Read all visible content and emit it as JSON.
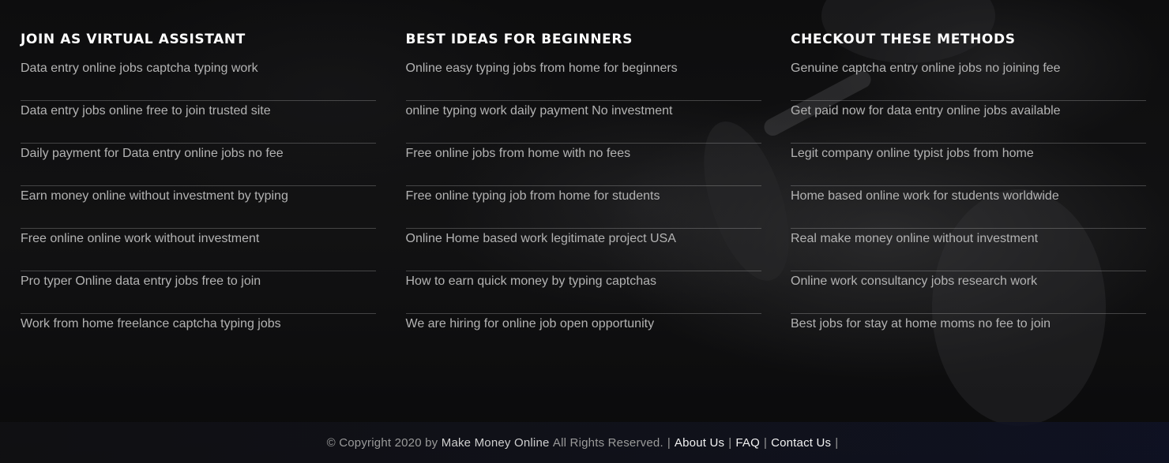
{
  "columns": [
    {
      "title": "JOIN AS VIRTUAL ASSISTANT",
      "links": [
        "Data entry online jobs captcha typing work",
        "Data entry jobs online free to join trusted site",
        "Daily payment for Data entry online jobs no fee",
        "Earn money online without investment by typing",
        "Free online online work without investment",
        "Pro typer Online data entry jobs free to join",
        "Work from home freelance captcha typing jobs"
      ]
    },
    {
      "title": "BEST IDEAS FOR BEGINNERS",
      "links": [
        "Online easy typing jobs from home for beginners",
        "online typing work daily payment No investment",
        "Free online jobs from home with no fees",
        "Free online typing job from home for students",
        "Online Home based work legitimate project USA",
        "How to earn quick money by typing captchas",
        "We are hiring for online job open opportunity"
      ]
    },
    {
      "title": "CHECKOUT THESE METHODS",
      "links": [
        "Genuine captcha entry online jobs no joining fee",
        "Get paid now for data entry online jobs available",
        "Legit company online typist jobs from home",
        "Home based online work for students worldwide",
        "Real make money online without investment",
        "Online work consultancy jobs research work",
        "Best jobs for stay at home moms no fee to join"
      ]
    }
  ],
  "footer": {
    "copyright_prefix": "© Copyright 2020 by",
    "brand": "Make Money Online",
    "rights": "All Rights Reserved.",
    "separator": "|",
    "about": "About Us",
    "faq": "FAQ",
    "contact": "Contact Us"
  }
}
